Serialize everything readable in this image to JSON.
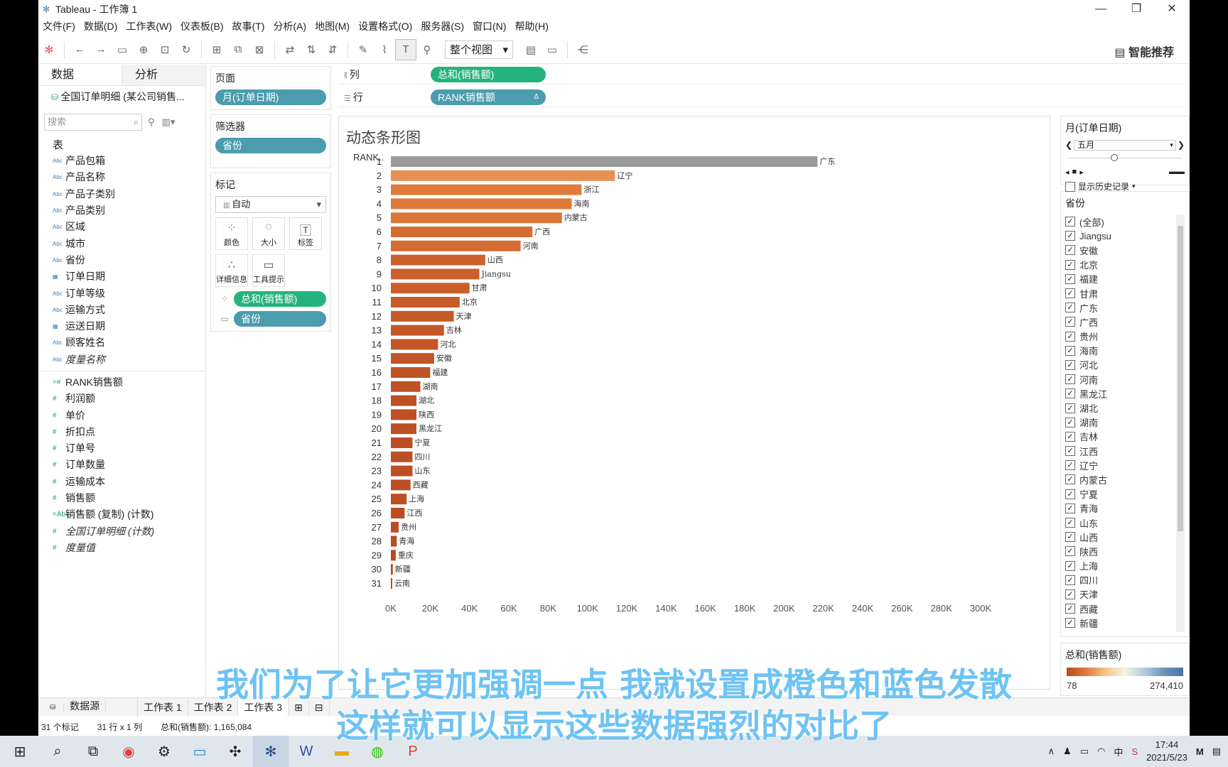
{
  "window": {
    "title": "Tableau - 工作簿 1",
    "minimize": "—",
    "maximize": "❐",
    "close": "✕"
  },
  "menu": [
    "文件(F)",
    "数据(D)",
    "工作表(W)",
    "仪表板(B)",
    "故事(T)",
    "分析(A)",
    "地图(M)",
    "设置格式(O)",
    "服务器(S)",
    "窗口(N)",
    "帮助(H)"
  ],
  "toolbar": {
    "view_mode": "整个视图",
    "smart_recommend": "智能推荐"
  },
  "data_pane": {
    "tab_data": "数据",
    "tab_analysis": "分析",
    "datasource": "全国订单明细 (某公司销售...",
    "search_placeholder": "搜索",
    "section_tables": "表",
    "dimensions": [
      {
        "type": "Abc",
        "name": "产品包箱"
      },
      {
        "type": "Abc",
        "name": "产品名称"
      },
      {
        "type": "Abc",
        "name": "产品子类别"
      },
      {
        "type": "Abc",
        "name": "产品类别"
      },
      {
        "type": "Abc",
        "name": "区域"
      },
      {
        "type": "Abc",
        "name": "城市"
      },
      {
        "type": "Abc",
        "name": "省份"
      },
      {
        "type": "▦",
        "name": "订单日期"
      },
      {
        "type": "Abc",
        "name": "订单等级"
      },
      {
        "type": "Abc",
        "name": "运输方式"
      },
      {
        "type": "▦",
        "name": "运送日期"
      },
      {
        "type": "Abc",
        "name": "顾客姓名"
      },
      {
        "type": "Abc",
        "name": "度量名称",
        "italic": true
      }
    ],
    "measures": [
      {
        "type": "=#",
        "name": "RANK销售额"
      },
      {
        "type": "#",
        "name": "利润额"
      },
      {
        "type": "#",
        "name": "单价"
      },
      {
        "type": "#",
        "name": "折扣点"
      },
      {
        "type": "#",
        "name": "订单号"
      },
      {
        "type": "#",
        "name": "订单数量"
      },
      {
        "type": "#",
        "name": "运输成本"
      },
      {
        "type": "#",
        "name": "销售额"
      },
      {
        "type": "=Abc",
        "name": "销售额 (复制) (计数)"
      },
      {
        "type": "#",
        "name": "全国订单明细 (计数)",
        "italic": true
      },
      {
        "type": "#",
        "name": "度量值",
        "italic": true
      }
    ]
  },
  "shelves": {
    "pages_title": "页面",
    "pages_pill": "月(订单日期)",
    "filters_title": "筛选器",
    "filters_pill": "省份",
    "marks_title": "标记",
    "marks_type": "自动",
    "mark_buttons": [
      "颜色",
      "大小",
      "标签",
      "详细信息",
      "工具提示"
    ],
    "mark_color_pill": "总和(销售额)",
    "mark_label_pill": "省份",
    "columns_label": "列",
    "columns_pill": "总和(销售额)",
    "rows_label": "行",
    "rows_pill": "RANK销售额"
  },
  "view": {
    "title": "动态条形图",
    "rank_header": "RANK.."
  },
  "chart_data": {
    "type": "bar",
    "orientation": "horizontal",
    "title": "动态条形图",
    "xlabel": "",
    "ylabel": "RANK..",
    "xlim": [
      0,
      300000
    ],
    "x_ticks": [
      "0K",
      "20K",
      "40K",
      "60K",
      "80K",
      "100K",
      "120K",
      "140K",
      "160K",
      "180K",
      "200K",
      "220K",
      "240K",
      "260K",
      "280K",
      "300K"
    ],
    "ranks": [
      1,
      2,
      3,
      4,
      5,
      6,
      7,
      8,
      9,
      10,
      11,
      12,
      13,
      14,
      15,
      16,
      17,
      18,
      19,
      20,
      21,
      22,
      23,
      24,
      25,
      26,
      27,
      28,
      29,
      30,
      31
    ],
    "categories": [
      "广东",
      "辽宁",
      "浙江",
      "海南",
      "内蒙古",
      "广西",
      "河南",
      "山西",
      "Jiangsu",
      "甘肃",
      "北京",
      "天津",
      "吉林",
      "河北",
      "安徽",
      "福建",
      "湖南",
      "湖北",
      "陕西",
      "黑龙江",
      "宁夏",
      "四川",
      "山东",
      "西藏",
      "上海",
      "江西",
      "贵州",
      "青海",
      "重庆",
      "新疆",
      "云南"
    ],
    "values": [
      217000,
      114000,
      97000,
      92000,
      87000,
      72000,
      66000,
      48000,
      45000,
      40000,
      35000,
      32000,
      27000,
      24000,
      22000,
      20000,
      15000,
      13000,
      13000,
      13000,
      11000,
      11000,
      11000,
      10000,
      8000,
      7000,
      4000,
      3000,
      2500,
      1000,
      500
    ],
    "color_range": [
      78,
      274410
    ],
    "colors": {
      "low": "#b84a21",
      "mid_low": "#e07a3a",
      "mid": "#f4c58a",
      "high": "#4e79a7"
    }
  },
  "right_pane": {
    "page_title": "月(订单日期)",
    "month_value": "五月",
    "show_history": "显示历史记录",
    "filter_title": "省份",
    "provinces": [
      "(全部)",
      "Jiangsu",
      "安徽",
      "北京",
      "福建",
      "甘肃",
      "广东",
      "广西",
      "贵州",
      "海南",
      "河北",
      "河南",
      "黑龙江",
      "湖北",
      "湖南",
      "吉林",
      "江西",
      "辽宁",
      "内蒙古",
      "宁夏",
      "青海",
      "山东",
      "山西",
      "陕西",
      "上海",
      "四川",
      "天津",
      "西藏",
      "新疆"
    ],
    "legend_title": "总和(销售额)",
    "legend_min": "78",
    "legend_max": "274,410"
  },
  "sheet_tabs": {
    "datasource": "数据源",
    "sheets": [
      "工作表 1",
      "工作表 2",
      "工作表 3"
    ],
    "active": 2
  },
  "status": {
    "marks": "31 个标记",
    "rows_cols": "31 行 x 1 列",
    "sum": "总和(销售额): 1,165,084"
  },
  "taskbar": {
    "time": "17:44",
    "date": "2021/5/23",
    "ime": "中"
  },
  "subtitles": {
    "line1": "我们为了让它更加强调一点 我就设置成橙色和蓝色发散",
    "line2": "这样就可以显示这些数据强烈的对比了"
  }
}
